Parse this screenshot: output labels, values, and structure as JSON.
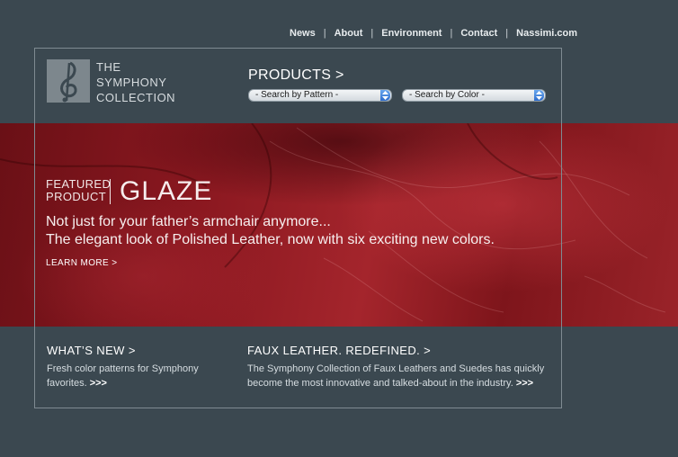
{
  "topnav": {
    "items": [
      "News",
      "About",
      "Environment",
      "Contact",
      "Nassimi.com"
    ],
    "separator": "|"
  },
  "logo": {
    "line1": "THE",
    "line2": "SYMPHONY",
    "line3": "COLLECTION",
    "icon": "treble-clef-icon"
  },
  "products": {
    "label": "PRODUCTS",
    "arrow": ">",
    "search_pattern": "- Search by Pattern -",
    "search_color": "- Search by Color -"
  },
  "featured": {
    "label_line1": "FEATURED",
    "label_line2": "PRODUCT",
    "title": "GLAZE",
    "tagline_line1": "Not just for your father’s armchair anymore...",
    "tagline_line2": "The elegant look of Polished Leather, now with six exciting new colors.",
    "learn_more": "LEARN MORE >"
  },
  "whats_new": {
    "title": "WHAT’S NEW",
    "arrow": ">",
    "text": "Fresh color patterns for Symphony favorites.",
    "more": ">>>"
  },
  "faux_leather": {
    "title": "FAUX LEATHER. REDEFINED.",
    "arrow": ">",
    "text": "The Symphony Collection of Faux Leathers and Suedes has quickly become the most innovative and talked-about in the industry.",
    "more": ">>>"
  },
  "colors": {
    "background": "#3b4850",
    "hero_red": "#8b1820",
    "frame": "#7f8b92",
    "select_arrow": "#2e6dcc"
  }
}
